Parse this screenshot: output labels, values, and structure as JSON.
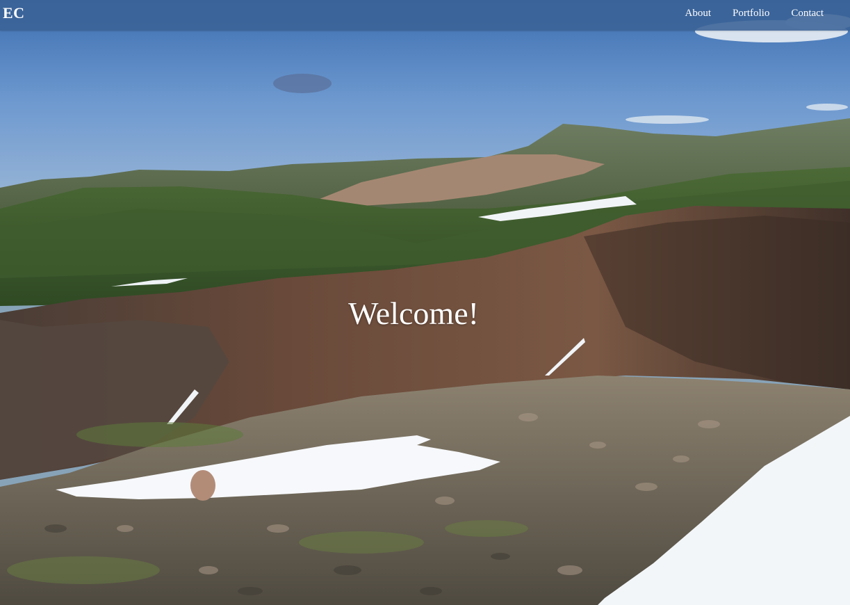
{
  "navbar": {
    "brand": "EC",
    "links": [
      {
        "label": "About"
      },
      {
        "label": "Portfolio"
      },
      {
        "label": "Contact"
      }
    ]
  },
  "hero": {
    "heading": "Welcome!",
    "background_image": "mountain-landscape-image"
  },
  "colors": {
    "navbar": "#3a6296",
    "text": "#ffffff",
    "sky": "#5a8cc8",
    "grass": "#3e5a2a",
    "rock": "#6b4a3a",
    "snow": "#f4f6f8"
  }
}
